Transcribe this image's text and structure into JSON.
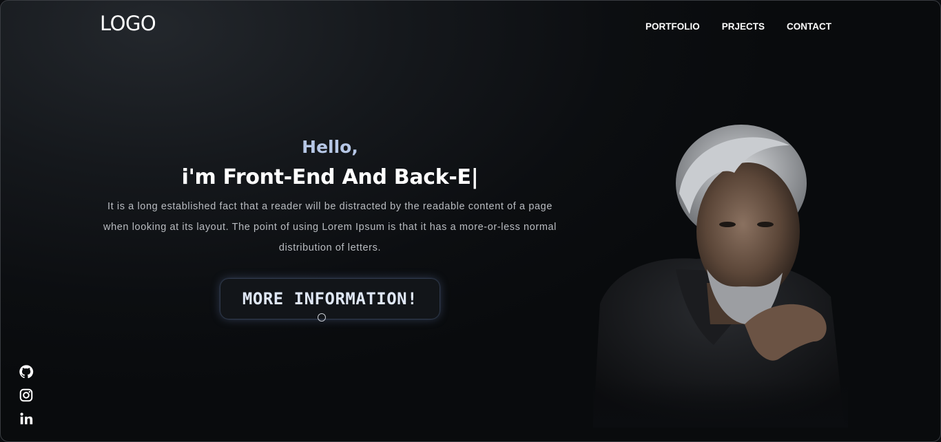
{
  "header": {
    "logo": "LOGO",
    "nav": [
      "PORTFOLIO",
      "PRJECTS",
      "CONTACT"
    ]
  },
  "hero": {
    "greeting": "Hello,",
    "role": "i'm Front-End And Back-E|",
    "description": "It is a long established fact that a reader will be distracted by the readable content of a page when looking at its layout. The point of using Lorem Ipsum is that it has a more-or-less normal distribution of letters.",
    "cta_label": "MORE INFORMATION!"
  },
  "social": {
    "icons": [
      "github-icon",
      "instagram-icon",
      "linkedin-icon"
    ]
  },
  "colors": {
    "background": "#0b0d10",
    "greeting": "#b6c7e6",
    "text": "#ffffff"
  }
}
